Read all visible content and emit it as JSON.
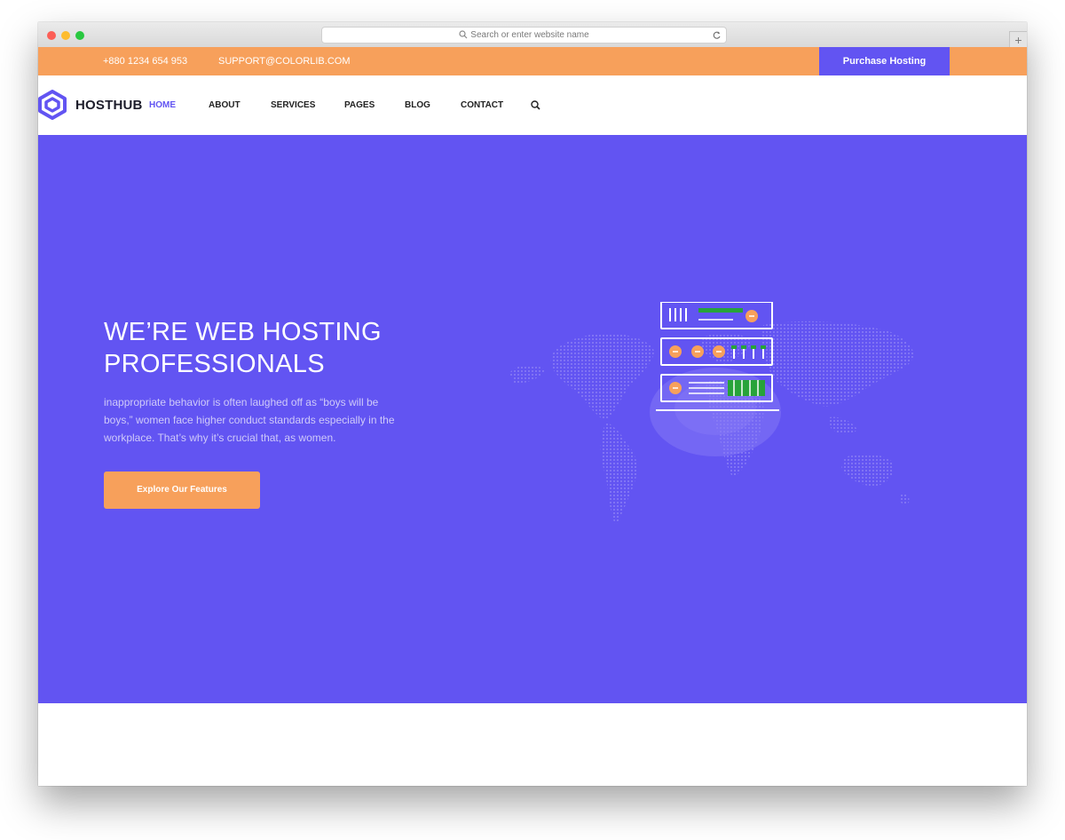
{
  "browser": {
    "address_placeholder": "Search or enter website name",
    "new_tab": "+"
  },
  "topbar": {
    "phone": "+880 1234 654 953",
    "email": "SUPPORT@COLORLIB.COM",
    "purchase_label": "Purchase Hosting"
  },
  "brand": {
    "name": "HOSTHUB"
  },
  "nav": {
    "items": [
      {
        "label": "HOME",
        "active": true
      },
      {
        "label": "ABOUT"
      },
      {
        "label": "SERVICES"
      },
      {
        "label": "PAGES"
      },
      {
        "label": "BLOG"
      },
      {
        "label": "CONTACT"
      }
    ]
  },
  "hero": {
    "title_line1": "WE’RE WEB HOSTING",
    "title_line2": "PROFESSIONALS",
    "text": "inappropriate behavior is often laughed off as “boys will be boys,” women face higher conduct standards especially in the workplace. That’s why it’s crucial that, as women.",
    "cta_label": "Explore Our Features"
  },
  "colors": {
    "primary": "#6254f2",
    "accent": "#f7a05b",
    "server_green": "#27a33a"
  }
}
